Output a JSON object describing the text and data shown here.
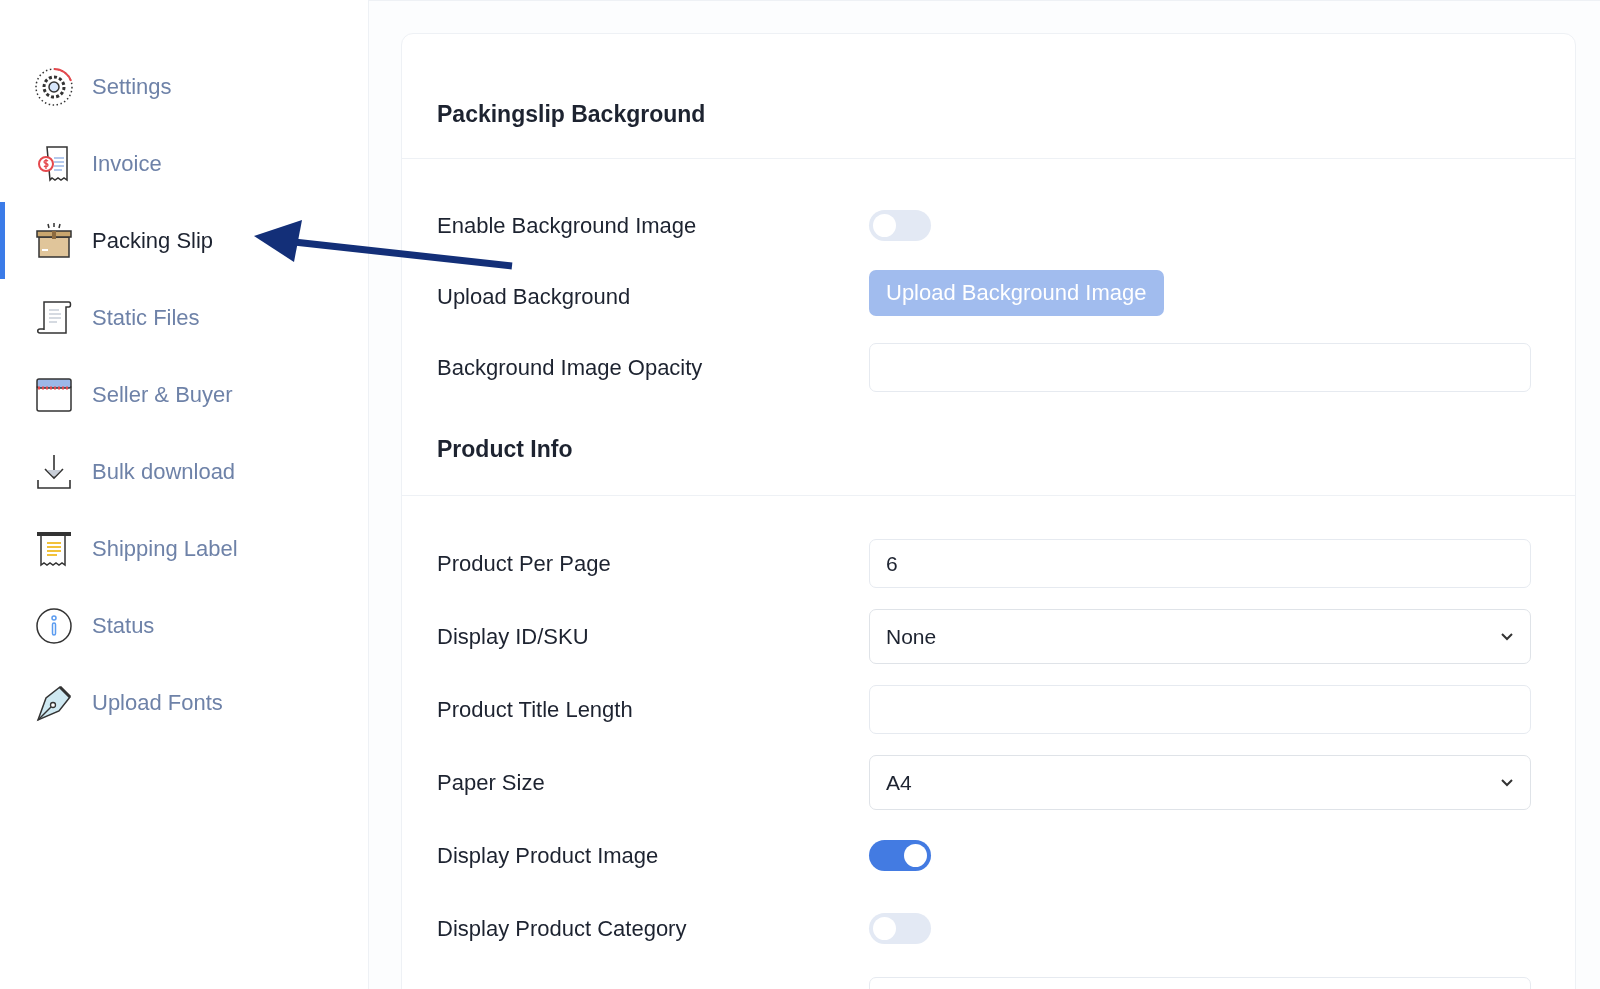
{
  "sidebar": {
    "items": [
      {
        "label": "Settings",
        "selected": false
      },
      {
        "label": "Invoice",
        "selected": false
      },
      {
        "label": "Packing Slip",
        "selected": true
      },
      {
        "label": "Static Files",
        "selected": false
      },
      {
        "label": "Seller & Buyer",
        "selected": false
      },
      {
        "label": "Bulk download",
        "selected": false
      },
      {
        "label": "Shipping Label",
        "selected": false
      },
      {
        "label": "Status",
        "selected": false
      },
      {
        "label": "Upload Fonts",
        "selected": false
      }
    ]
  },
  "sections": [
    {
      "title": "Packingslip Background",
      "rows": [
        {
          "kind": "toggle",
          "label": "Enable Background Image",
          "on": false
        },
        {
          "kind": "button",
          "label": "Upload Background",
          "button": "Upload Background Image"
        },
        {
          "kind": "input",
          "label": "Background Image Opacity"
        }
      ]
    },
    {
      "title": "Product Info",
      "rows": [
        {
          "kind": "input",
          "label": "Product Per Page",
          "value": "6"
        },
        {
          "kind": "select",
          "label": "Display ID/SKU",
          "value": "None"
        },
        {
          "kind": "input",
          "label": "Product Title Length"
        },
        {
          "kind": "select",
          "label": "Paper Size",
          "value": "A4"
        },
        {
          "kind": "toggle",
          "label": "Display Product Image",
          "on": true
        },
        {
          "kind": "toggle",
          "label": "Display Product Category",
          "on": false
        },
        {
          "kind": "input"
        }
      ]
    }
  ]
}
